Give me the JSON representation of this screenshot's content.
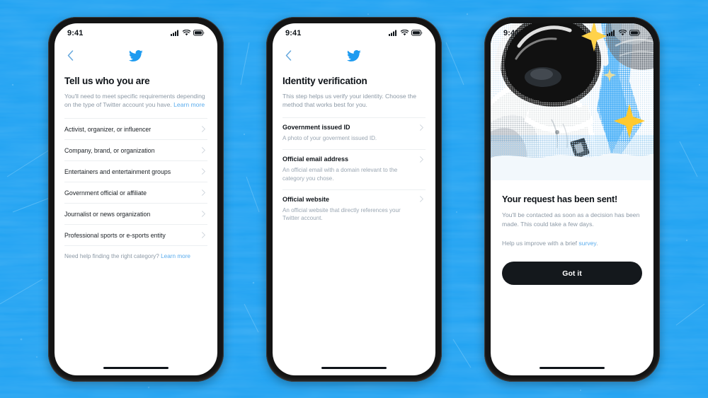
{
  "theme": {
    "background": "#1DA1F2",
    "accent": "#1D9BF0",
    "link": "#5AACED",
    "text_primary": "#0F1419",
    "text_muted": "#8B98A5",
    "button_bg": "#14181C"
  },
  "status_bar": {
    "time": "9:41",
    "icons": [
      "signal-icon",
      "wifi-icon",
      "battery-icon"
    ]
  },
  "phones": [
    {
      "id": "phone-categories",
      "nav": {
        "back": "back-chevron-icon",
        "logo": "twitter-bird-icon"
      },
      "title": "Tell us who you are",
      "subtitle": "You'll need to meet specific requirements depending on the type of Twitter account you have.",
      "subtitle_link": "Learn more",
      "categories": [
        "Activist, organizer, or influencer",
        "Company, brand, or organization",
        "Entertainers and entertainment groups",
        "Government official or affiliate",
        "Journalist or news organization",
        "Professional sports or e-sports entity"
      ],
      "footer_text": "Need help finding the right category?",
      "footer_link": "Learn more"
    },
    {
      "id": "phone-identity",
      "nav": {
        "back": "back-chevron-icon",
        "logo": "twitter-bird-icon"
      },
      "title": "Identity verification",
      "subtitle": "This step helps us verify your identity. Choose the method that works best for you.",
      "methods": [
        {
          "title": "Government issued ID",
          "description": "A photo of your goverment issued ID."
        },
        {
          "title": "Official email address",
          "description": "An official email with a domain relevant to the category you chose."
        },
        {
          "title": "Official website",
          "description": "An official website that directly references your Twitter account."
        }
      ]
    },
    {
      "id": "phone-confirmation",
      "hero_alt": "halftone-astronaut-illustration",
      "title": "Your request has been sent!",
      "body": "You'll be contacted as soon as a decision has been made. This could take a few days.",
      "survey_prefix": "Help us improve with a brief ",
      "survey_link": "survey",
      "survey_suffix": ".",
      "cta_label": "Got it"
    }
  ]
}
